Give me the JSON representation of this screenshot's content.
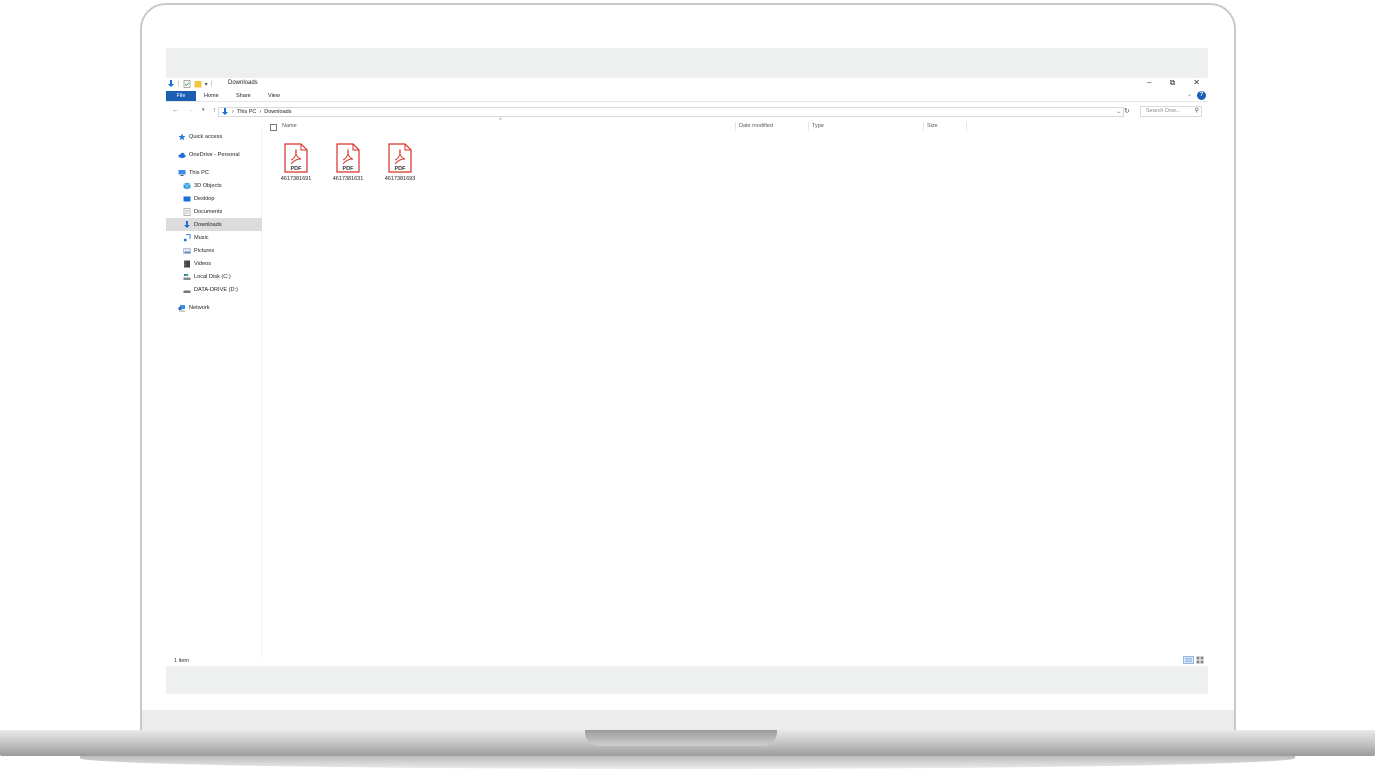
{
  "window": {
    "title": "Downloads",
    "controls": [
      "–",
      "⧉",
      "✕"
    ]
  },
  "ribbon": {
    "tabs": [
      "File",
      "Home",
      "Share",
      "View"
    ],
    "help": "?"
  },
  "address": {
    "path": [
      "This PC",
      "Downloads"
    ],
    "separator": "›",
    "search_placeholder": "Search Dow..."
  },
  "sidebar": {
    "items": [
      {
        "label": "Quick access",
        "icon": "star-icon"
      },
      {
        "label": "OneDrive - Personal",
        "icon": "cloud-icon"
      },
      {
        "label": "This PC",
        "icon": "computer-icon"
      },
      {
        "label": "3D Objects",
        "icon": "cube-icon"
      },
      {
        "label": "Desktop",
        "icon": "desktop-icon"
      },
      {
        "label": "Documents",
        "icon": "document-icon"
      },
      {
        "label": "Downloads",
        "icon": "download-icon",
        "selected": true
      },
      {
        "label": "Music",
        "icon": "music-icon"
      },
      {
        "label": "Pictures",
        "icon": "picture-icon"
      },
      {
        "label": "Videos",
        "icon": "video-icon"
      },
      {
        "label": "Local Disk (C:)",
        "icon": "disk-icon"
      },
      {
        "label": "DATA-DRIVE (D:)",
        "icon": "drive-icon"
      },
      {
        "label": "Network",
        "icon": "network-icon"
      }
    ]
  },
  "columns": {
    "name": "Name",
    "date_modified": "Date modified",
    "type": "Type",
    "size": "Size"
  },
  "files": [
    {
      "name": "4617381691",
      "badge": "PDF"
    },
    {
      "name": "4617381631",
      "badge": "PDF"
    },
    {
      "name": "4617381693",
      "badge": "PDF"
    }
  ],
  "status": {
    "count": "1 item"
  },
  "colors": {
    "accent": "#1a5fb4",
    "pdf_red": "#d93025",
    "folder_yellow": "#f4c542",
    "selected_bg": "#dcdcdc"
  }
}
